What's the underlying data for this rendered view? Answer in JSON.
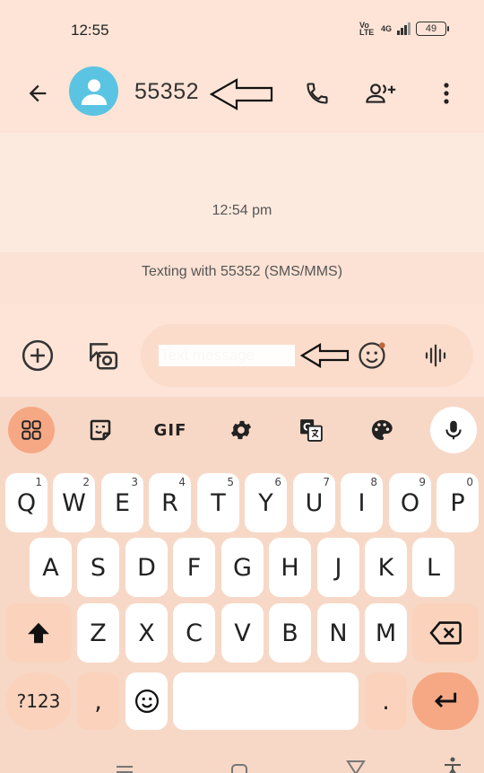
{
  "status_bar": {
    "time": "12:55",
    "volte": "Vo LTE",
    "network": "4G",
    "battery": "49"
  },
  "header": {
    "contact_name": "55352",
    "icons": [
      "back-arrow-icon",
      "contact-avatar-icon",
      "phone-icon",
      "add-person-icon",
      "more-vert-icon"
    ]
  },
  "conversation": {
    "timestamp": "12:54 pm",
    "texting_info": "Texting with 55352 (SMS/MMS)"
  },
  "compose": {
    "placeholder": "Text message",
    "icons": [
      "add-circle-icon",
      "gallery-icon",
      "emoji-icon",
      "voice-icon"
    ]
  },
  "keyboard": {
    "toolbar": {
      "gif_label": "GIF",
      "icons": [
        "apps-grid-icon",
        "sticker-icon",
        "gif-icon",
        "settings-icon",
        "translate-icon",
        "palette-icon",
        "mic-icon"
      ]
    },
    "row1": [
      {
        "label": "Q",
        "hint": "1"
      },
      {
        "label": "W",
        "hint": "2"
      },
      {
        "label": "E",
        "hint": "3"
      },
      {
        "label": "R",
        "hint": "4"
      },
      {
        "label": "T",
        "hint": "5"
      },
      {
        "label": "Y",
        "hint": "6"
      },
      {
        "label": "U",
        "hint": "7"
      },
      {
        "label": "I",
        "hint": "8"
      },
      {
        "label": "O",
        "hint": "9"
      },
      {
        "label": "P",
        "hint": "0"
      }
    ],
    "row2": [
      "A",
      "S",
      "D",
      "F",
      "G",
      "H",
      "J",
      "K",
      "L"
    ],
    "row3": [
      "Z",
      "X",
      "C",
      "V",
      "B",
      "N",
      "M"
    ],
    "row4": {
      "symbols": "?123",
      "comma": ",",
      "period": "."
    }
  },
  "colors": {
    "background": "#fde4d6",
    "keyboard": "#f7d8c6",
    "accent": "#f6a885",
    "avatar": "#5bc4e3"
  }
}
